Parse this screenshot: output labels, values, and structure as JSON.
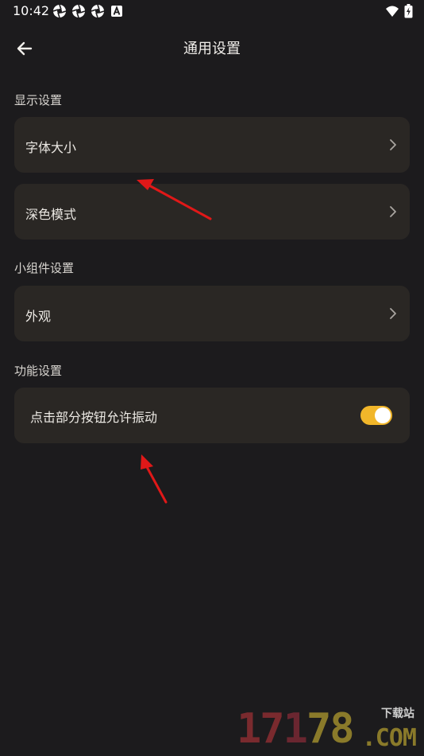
{
  "status_bar": {
    "time": "10:42",
    "notification_icons": [
      "aperture-icon",
      "aperture-icon",
      "aperture-icon",
      "a-badge-icon"
    ],
    "system_icons": [
      "wifi-icon",
      "battery-charging-icon"
    ]
  },
  "app_bar": {
    "title": "通用设置",
    "back_icon": "back-arrow-icon"
  },
  "sections": {
    "display": {
      "label": "显示设置",
      "items": [
        {
          "label": "字体大小",
          "icon": "chevron-right-icon"
        },
        {
          "label": "深色模式",
          "icon": "chevron-right-icon"
        }
      ]
    },
    "widget": {
      "label": "小组件设置",
      "items": [
        {
          "label": "外观",
          "icon": "chevron-right-icon"
        }
      ]
    },
    "function": {
      "label": "功能设置",
      "items": [
        {
          "label": "点击部分按钮允许振动",
          "toggle_on": true
        }
      ]
    }
  },
  "colors": {
    "background": "#1c1b1d",
    "card": "#2a2724",
    "toggle_accent": "#f1b62a",
    "annotation_arrow": "#e01818"
  },
  "watermark": {
    "number": "17178",
    "site_label": "下载站",
    "domain": ".COM"
  }
}
